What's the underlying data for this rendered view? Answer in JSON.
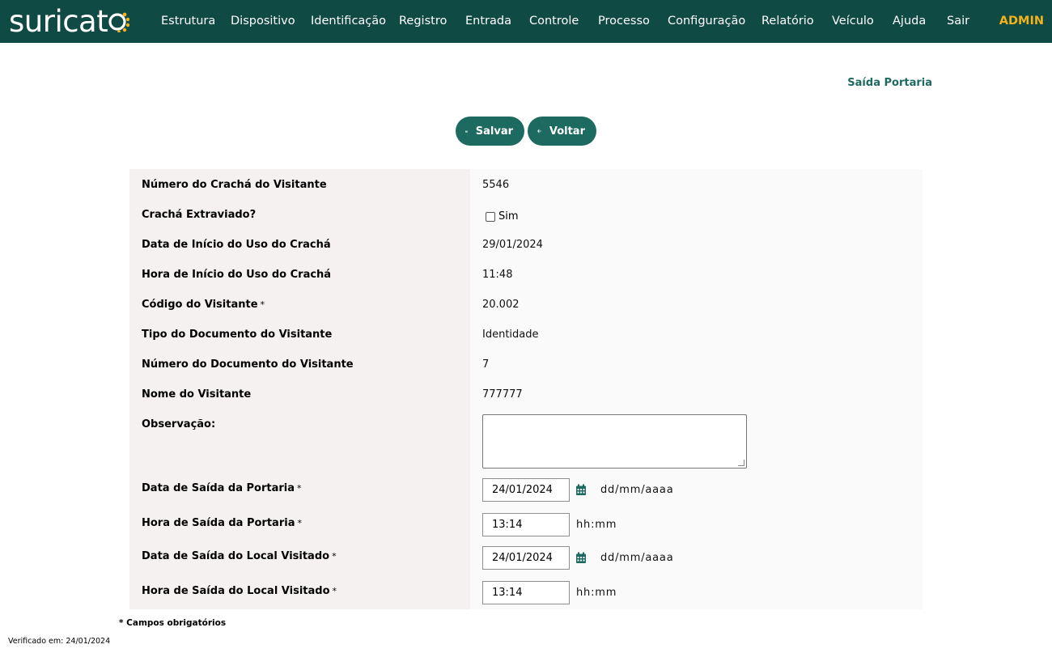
{
  "brand": {
    "name": "suricat"
  },
  "nav": {
    "items": [
      "Estrutura",
      "Dispositivo",
      "Identificação",
      "Registro",
      "Entrada",
      "Controle",
      "Processo",
      "Configuração",
      "Relatório",
      "Veículo",
      "Ajuda",
      "Sair"
    ],
    "user": "ADMIN"
  },
  "page": {
    "title": "Saída Portaria"
  },
  "actions": {
    "save_label": "Salvar",
    "back_label": "Voltar"
  },
  "form": {
    "badge_number_label": "Número do Crachá do Visitante",
    "badge_number": "5546",
    "badge_lost_label": "Crachá Extraviado?",
    "badge_lost_option": "Sim",
    "badge_start_date_label": "Data de Início do Uso do Crachá",
    "badge_start_date": "29/01/2024",
    "badge_start_time_label": "Hora de Início do Uso do Crachá",
    "badge_start_time": "11:48",
    "visitor_code_label": "Código do Visitante",
    "visitor_code": "20.002",
    "doc_type_label": "Tipo do Documento do Visitante",
    "doc_type": "Identidade",
    "doc_number_label": "Número do Documento do Visitante",
    "doc_number": "7",
    "visitor_name_label": "Nome do Visitante",
    "visitor_name": "777777",
    "observation_label": "Observação:",
    "observation": "",
    "exit_gate_date_label": "Data de Saída da Portaria",
    "exit_gate_date": "24/01/2024",
    "exit_gate_time_label": "Hora de Saída da Portaria",
    "exit_gate_time": "13:14",
    "exit_place_date_label": "Data de Saída do Local Visitado",
    "exit_place_date": "24/01/2024",
    "exit_place_time_label": "Hora de Saída do Local Visitado",
    "exit_place_time": "13:14",
    "required_mark": "*",
    "date_format": "dd/mm/aaaa",
    "time_format": "hh:mm"
  },
  "footer": {
    "required_note": "* Campos obrigatórios",
    "verified": "Verificado em: 24/01/2024"
  },
  "colors": {
    "header_bg": "#0f4a44",
    "accent": "#1d6a61",
    "admin": "#f2b21c"
  },
  "icons": {
    "save": "floppy-disk-icon",
    "back": "arrow-left-icon",
    "calendar": "calendar-icon"
  }
}
